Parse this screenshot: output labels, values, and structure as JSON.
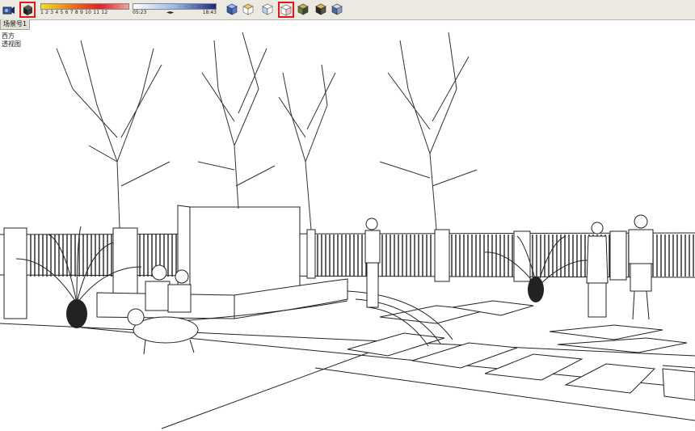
{
  "toolbar": {
    "buttons": [
      {
        "name": "camera-icon",
        "active": false
      },
      {
        "name": "shadows-toggle-icon",
        "active": true
      }
    ],
    "month_slider": {
      "ticks": "1  2  3  4  5  6  7  8  9  10  11  12",
      "colors": [
        "#f4e020",
        "#f07818",
        "#e02020",
        "#f0a0a0"
      ]
    },
    "time_slider": {
      "start_label": "05:23",
      "arrows_label": "◄►",
      "end_label": "18:43",
      "colors": [
        "#ffffff",
        "#9ab8e8",
        "#1a2a7a"
      ]
    },
    "view_buttons": [
      {
        "name": "iso-view-icon",
        "active": false
      },
      {
        "name": "top-view-icon",
        "active": false
      },
      {
        "name": "front-view-icon",
        "active": false
      },
      {
        "name": "right-view-icon",
        "active": true
      },
      {
        "name": "back-view-icon",
        "active": false
      },
      {
        "name": "left-view-icon",
        "active": false
      },
      {
        "name": "bottom-view-icon",
        "active": false
      }
    ]
  },
  "scene_tab": {
    "label": "场景号1"
  },
  "scene_info": {
    "line1": "西方",
    "line2": "透视图"
  }
}
